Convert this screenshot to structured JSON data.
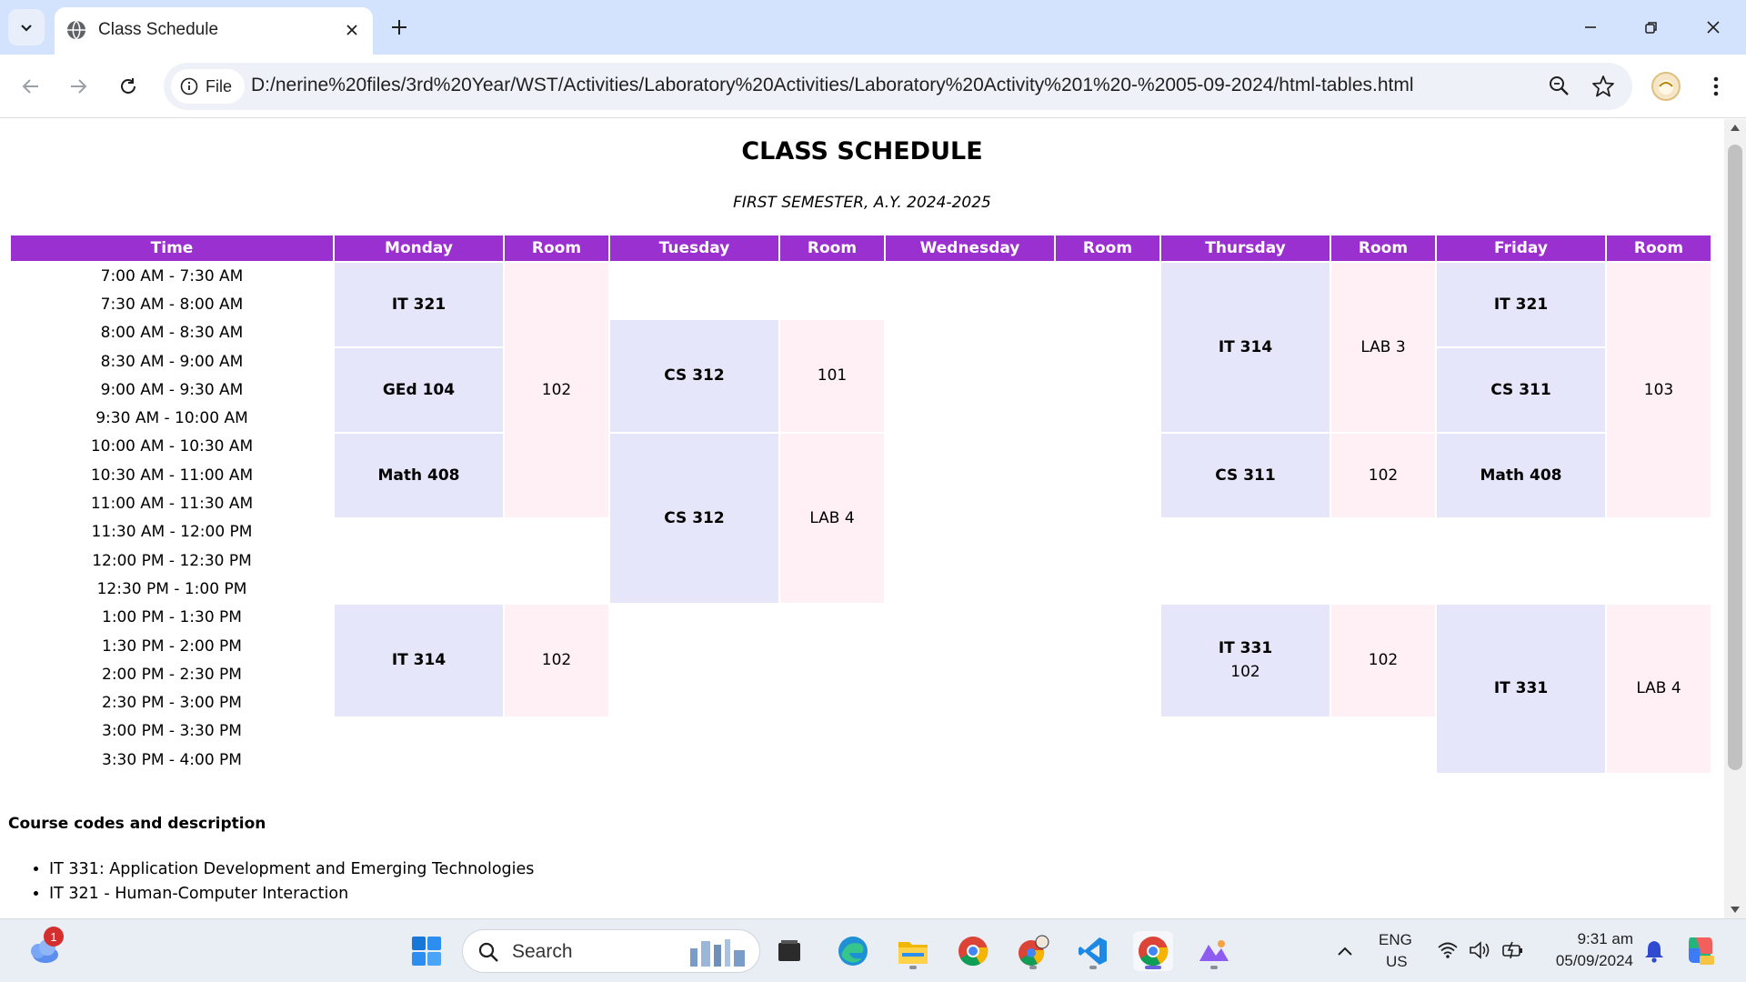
{
  "browser": {
    "tab_title": "Class Schedule",
    "site_info_label": "File",
    "url": "D:/nerine%20files/3rd%20Year/WST/Activities/Laboratory%20Activities/Laboratory%20Activity%201%20-%2005-09-2024/html-tables.html",
    "icons": [
      "tab-search-icon",
      "globe-icon",
      "close-icon",
      "plus-icon",
      "minimize-icon",
      "restore-icon",
      "back-icon",
      "forward-icon",
      "reload-icon",
      "info-icon",
      "zoom-icon",
      "star-icon",
      "kebab-menu-icon"
    ]
  },
  "page": {
    "title": "CLASS SCHEDULE",
    "subtitle": "FIRST SEMESTER, A.Y. 2024-2025",
    "table": {
      "headers": [
        "Time",
        "Monday",
        "Room",
        "Tuesday",
        "Room",
        "Wednesday",
        "Room",
        "Thursday",
        "Room",
        "Friday",
        "Room"
      ],
      "times": [
        "7:00 AM - 7:30 AM",
        "7:30 AM - 8:00 AM",
        "8:00 AM - 8:30 AM",
        "8:30 AM - 9:00 AM",
        "9:00 AM - 9:30 AM",
        "9:30 AM - 10:00 AM",
        "10:00 AM - 10:30 AM",
        "10:30 AM - 11:00 AM",
        "11:00 AM - 11:30 AM",
        "11:30 AM - 12:00 PM",
        "12:00 PM - 12:30 PM",
        "12:30 PM - 1:00 PM",
        "1:00 PM - 1:30 PM",
        "1:30 PM - 2:00 PM",
        "2:00 PM - 2:30 PM",
        "2:30 PM - 3:00 PM",
        "3:00 PM - 3:30 PM",
        "3:30 PM - 4:00 PM"
      ],
      "cells": {
        "mon_1": "IT 321",
        "mon_2": "GEd 104",
        "mon_3": "Math 408",
        "mon_4": "IT 314",
        "mon_room_1": "102",
        "mon_room_2": "102",
        "tue_1": "CS 312",
        "tue_room_1": "101",
        "tue_2": "CS 312",
        "tue_room_2": "LAB 4",
        "thu_1": "IT 314",
        "thu_room_1": "LAB 3",
        "thu_2": "CS 311",
        "thu_room_2": "102",
        "thu_3": "IT 331",
        "thu_3_sub": "102",
        "thu_room_3": "102",
        "fri_1": "IT 321",
        "fri_2": "CS 311",
        "fri_3": "Math 408",
        "fri_room_1": "103",
        "fri_4": "IT 331",
        "fri_room_2": "LAB 4"
      }
    },
    "codes_heading": "Course codes and description",
    "codes": [
      "IT 331: Application Development and Emerging Technologies",
      "IT 321 - Human-Computer Interaction"
    ]
  },
  "taskbar": {
    "weather_badge": "1",
    "search_label": "Search",
    "lang_line1": "ENG",
    "lang_line2": "US",
    "time": "9:31 am",
    "date": "05/09/2024",
    "icons": [
      "weather-icon",
      "start-icon",
      "search-icon",
      "task-view-icon",
      "edge-icon",
      "file-explorer-icon",
      "chrome-icon",
      "chrome-profile-icon",
      "vscode-icon",
      "chrome-active-icon",
      "photos-icon",
      "chevron-up-icon",
      "wifi-icon",
      "volume-icon",
      "battery-icon",
      "notification-bell-icon",
      "copilot-icon"
    ]
  }
}
